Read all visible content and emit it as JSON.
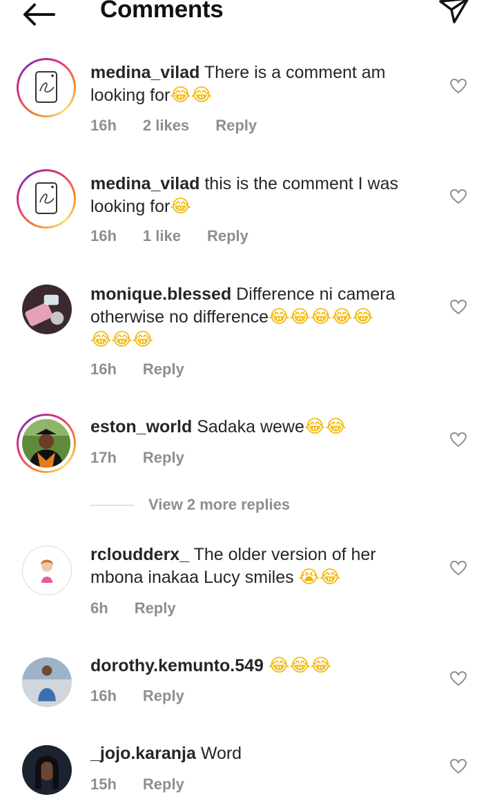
{
  "header": {
    "title": "Comments",
    "back_icon": "back-arrow-icon",
    "send_icon": "paper-plane-icon"
  },
  "comments": [
    {
      "user": "medina_vilad",
      "text": "There is a comment am looking for",
      "emoji": "😂😂",
      "time": "16h",
      "likes": "2 likes",
      "reply": "Reply"
    },
    {
      "user": "medina_vilad",
      "text": "this is the comment I was looking for",
      "emoji": "😂",
      "time": "16h",
      "likes": "1 like",
      "reply": "Reply"
    },
    {
      "user": "monique.blessed",
      "text": "Difference ni camera otherwise no difference",
      "emoji": "😂😂😂😂😂",
      "emoji2": "😂😂😂",
      "time": "16h",
      "reply": "Reply"
    },
    {
      "user": "eston_world",
      "text": "Sadaka wewe",
      "emoji": "😂😂",
      "time": "17h",
      "reply": "Reply"
    },
    {
      "user": "rcloudderx_",
      "text": "The older version of her mbona inakaa Lucy smiles",
      "emoji": "😭😂",
      "time": "6h",
      "reply": "Reply"
    },
    {
      "user": "dorothy.kemunto.549",
      "text": "",
      "emoji": "😂😂😂",
      "time": "16h",
      "reply": "Reply"
    },
    {
      "user": "_jojo.karanja",
      "text": "Word",
      "emoji": "",
      "time": "15h",
      "reply": "Reply"
    }
  ],
  "view_more": "View 2 more replies",
  "colors": {
    "text": "#262626",
    "meta": "#8e8e8e",
    "background": "#ffffff"
  }
}
